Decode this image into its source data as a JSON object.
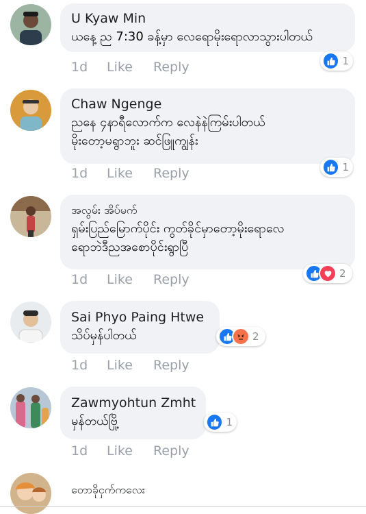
{
  "comments": [
    {
      "author": "U Kyaw Min",
      "lines": [
        "ယနေ့ ည 7:30 ခန့်မှာ လေရောမိုးရောလာသွားပါတယ်"
      ],
      "time": "1d",
      "like": "Like",
      "reply": "Reply",
      "reactions": [
        "like"
      ],
      "reaction_count": "1"
    },
    {
      "author": "Chaw Ngenge",
      "lines": [
        "ညနေ ၄နာရီလောက်က လေနဲနဲကြမ်းပါတယ်",
        "မိုးတော့မရွာဘူး ဆင်ဖြူကျွန်း"
      ],
      "time": "1d",
      "like": "Like",
      "reply": "Reply",
      "reactions": [
        "like"
      ],
      "reaction_count": "1"
    },
    {
      "author": "အလွမ်း အိပ်မက်",
      "lines": [
        "ရှမ်းပြည်မြောက်ပိုင်း ကွတ်ခိုင်မှာတော့မိုးရောလေ",
        "ရောဘဲဒီညအစောပိုင်းရွာပြီ"
      ],
      "time": "1d",
      "like": "Like",
      "reply": "Reply",
      "reactions": [
        "like",
        "love"
      ],
      "reaction_count": "2"
    },
    {
      "author": "Sai Phyo Paing Htwe",
      "lines": [
        "သိပ်မှန်ပါတယ်"
      ],
      "time": "1d",
      "like": "Like",
      "reply": "Reply",
      "reactions": [
        "like",
        "angry"
      ],
      "reaction_count": "2"
    },
    {
      "author": "Zawmyohtun Zmht",
      "lines": [
        "မှန်တယ်ဗြို့"
      ],
      "time": "1d",
      "like": "Like",
      "reply": "Reply",
      "reactions": [
        "like"
      ],
      "reaction_count": "1"
    },
    {
      "author": "တောခိုငှက်ကလေး"
    }
  ],
  "colors": {
    "bubble": "#f0f2f5",
    "muted": "#9aa0a8",
    "like": "#1877f2",
    "love": "#f33e58",
    "angry": "#f7714b"
  }
}
